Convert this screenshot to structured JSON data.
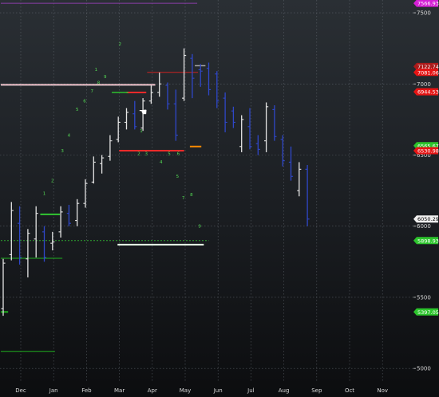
{
  "chart_data": {
    "type": "ohlc",
    "x_categories": [
      "Dec",
      "Jan",
      "Feb",
      "Mar",
      "Apr",
      "May",
      "Jun",
      "Jul",
      "Aug",
      "Sep",
      "Oct",
      "Nov"
    ],
    "yticks": [
      "7500",
      "7000",
      "6500",
      "6000",
      "5500",
      "5000"
    ],
    "ylim": [
      4900,
      7590
    ],
    "grid": true,
    "price_labels": [
      {
        "text": "7566.93",
        "value": 7566.9,
        "color": "#d51fd5"
      },
      {
        "text": "7122.74",
        "value": 7122.7,
        "color": "#aa1a1a"
      },
      {
        "text": "7081.06",
        "value": 7081.1,
        "color": "#e61414"
      },
      {
        "text": "6944.53",
        "value": 6944.5,
        "color": "#e61414"
      },
      {
        "text": "6565.67",
        "value": 6565.7,
        "color": "#2cc42c"
      },
      {
        "text": "6530.98",
        "value": 6531.0,
        "color": "#e61414"
      },
      {
        "text": "6050.29",
        "value": 6050.3,
        "color": "#f0f0f0"
      },
      {
        "text": "5898.93",
        "value": 5898.9,
        "color": "#2cc42c"
      },
      {
        "text": "5397.05",
        "value": 5397.1,
        "color": "#2cc42c"
      }
    ],
    "bars": [
      {
        "open": 5420,
        "high": 5770,
        "low": 5370,
        "close": 5740
      },
      {
        "open": 5800,
        "high": 6170,
        "low": 5760,
        "close": 6110
      },
      {
        "open": 6020,
        "high": 6140,
        "low": 5730,
        "close": 5780
      },
      {
        "open": 5770,
        "high": 5980,
        "low": 5640,
        "close": 5950
      },
      {
        "open": 5910,
        "high": 6140,
        "low": 5780,
        "close": 6090
      },
      {
        "open": 5960,
        "high": 6000,
        "low": 5750,
        "close": 5780
      },
      {
        "open": 5880,
        "high": 5960,
        "low": 5830,
        "close": 5890
      },
      {
        "open": 5960,
        "high": 6140,
        "low": 5920,
        "close": 6100
      },
      {
        "open": 6090,
        "high": 6150,
        "low": 6000,
        "close": 6020
      },
      {
        "open": 6040,
        "high": 6190,
        "low": 6000,
        "close": 6160
      },
      {
        "open": 6160,
        "high": 6330,
        "low": 6130,
        "close": 6300
      },
      {
        "open": 6310,
        "high": 6490,
        "low": 6300,
        "close": 6450
      },
      {
        "open": 6440,
        "high": 6500,
        "low": 6370,
        "close": 6480
      },
      {
        "open": 6490,
        "high": 6640,
        "low": 6460,
        "close": 6600
      },
      {
        "open": 6610,
        "high": 6770,
        "low": 6590,
        "close": 6730
      },
      {
        "open": 6730,
        "high": 6830,
        "low": 6680,
        "close": 6800
      },
      {
        "open": 6790,
        "high": 6880,
        "low": 6680,
        "close": 6700
      },
      {
        "open": 6690,
        "high": 6900,
        "low": 6670,
        "close": 6880
      },
      {
        "open": 6880,
        "high": 6990,
        "low": 6860,
        "close": 6940
      },
      {
        "open": 6940,
        "high": 7080,
        "low": 6910,
        "close": 7000
      },
      {
        "open": 6990,
        "high": 7010,
        "low": 6820,
        "close": 6860
      },
      {
        "open": 6860,
        "high": 6960,
        "low": 6600,
        "close": 6640
      },
      {
        "open": 6900,
        "high": 7250,
        "low": 6880,
        "close": 7200
      },
      {
        "open": 7180,
        "high": 7210,
        "low": 6900,
        "close": 7040
      },
      {
        "open": 7100,
        "high": 7140,
        "low": 6980,
        "close": 7090
      },
      {
        "open": 7110,
        "high": 7150,
        "low": 6920,
        "close": 6960
      },
      {
        "open": 7070,
        "high": 7090,
        "low": 6830,
        "close": 6880
      },
      {
        "open": 6900,
        "high": 6940,
        "low": 6660,
        "close": 6730
      },
      {
        "open": 6810,
        "high": 6840,
        "low": 6690,
        "close": 6730
      },
      {
        "open": 6560,
        "high": 6780,
        "low": 6520,
        "close": 6750
      },
      {
        "open": 6700,
        "high": 6830,
        "low": 6540,
        "close": 6560
      },
      {
        "open": 6580,
        "high": 6640,
        "low": 6500,
        "close": 6540
      },
      {
        "open": 6600,
        "high": 6870,
        "low": 6520,
        "close": 6840
      },
      {
        "open": 6820,
        "high": 6850,
        "low": 6600,
        "close": 6630
      },
      {
        "open": 6610,
        "high": 6640,
        "low": 6420,
        "close": 6460
      },
      {
        "open": 6450,
        "high": 6560,
        "low": 6320,
        "close": 6350
      },
      {
        "open": 6250,
        "high": 6450,
        "low": 6210,
        "close": 6400
      },
      {
        "open": 6400,
        "high": 6430,
        "low": 6000,
        "close": 6050
      }
    ],
    "levels": [
      {
        "value": 7566.9,
        "from": 0.0,
        "to": 23.6,
        "color": "#8a3fa8",
        "width": 1
      },
      {
        "value": 6994.0,
        "from": 0.0,
        "to": 18.5,
        "color": "#ffffff",
        "width": 2
      },
      {
        "value": 6994.0,
        "from": 0.0,
        "to": 18.5,
        "color": "#e89aa8",
        "width": 1
      },
      {
        "value": 7081.1,
        "from": 17.8,
        "to": 23.7,
        "color": "#cc2222",
        "width": 1
      },
      {
        "value": 7128.0,
        "from": 23.6,
        "to": 24.6,
        "color": "#a8a8a8",
        "width": 1.5
      },
      {
        "value": 6940.0,
        "from": 15.3,
        "to": 17.4,
        "color": "#ff2a2a",
        "width": 2
      },
      {
        "value": 6531.0,
        "from": 14.4,
        "to": 22.0,
        "color": "#ff2a2a",
        "width": 2
      },
      {
        "value": 6560.0,
        "from": 23.0,
        "to": 24.1,
        "color": "#ff8a00",
        "width": 2
      },
      {
        "value": 5898.9,
        "from": 0.0,
        "to": 25.0,
        "color": "#2ea62e",
        "width": 1,
        "dash": "2,2"
      },
      {
        "value": 5870.0,
        "from": 14.2,
        "to": 24.4,
        "color": "#eaffea",
        "width": 2
      },
      {
        "value": 6083.0,
        "from": 4.8,
        "to": 6.9,
        "color": "#32c832",
        "width": 2
      },
      {
        "value": 5774.0,
        "from": 0.0,
        "to": 7.2,
        "color": "#1fb01f",
        "width": 1
      },
      {
        "value": 5397.1,
        "from": 0.0,
        "to": 0.6,
        "color": "#1fb01f",
        "width": 2
      },
      {
        "value": 5120.0,
        "from": 0.0,
        "to": 6.3,
        "color": "#1fb01f",
        "width": 1
      },
      {
        "value": 6940.0,
        "from": 13.5,
        "to": 15.2,
        "color": "#2ec22e",
        "width": 1.5
      }
    ],
    "count_labels": [
      {
        "text": "1",
        "bar": 5.0,
        "value": 6220,
        "color": "#55dd55"
      },
      {
        "text": "2",
        "bar": 6.0,
        "value": 6310,
        "color": "#55dd55"
      },
      {
        "text": "3",
        "bar": 7.2,
        "value": 6520,
        "color": "#55dd55"
      },
      {
        "text": "4",
        "bar": 8.0,
        "value": 6630,
        "color": "#ff3030"
      },
      {
        "text": "5",
        "bar": 9.0,
        "value": 6810,
        "color": "#55dd55"
      },
      {
        "text": "6",
        "bar": 9.9,
        "value": 6870,
        "color": "#55dd55"
      },
      {
        "text": "7",
        "bar": 10.8,
        "value": 6940,
        "color": "#55dd55"
      },
      {
        "text": "8",
        "bar": 11.6,
        "value": 7000,
        "color": "#55dd55"
      },
      {
        "text": "9",
        "bar": 12.4,
        "value": 7040,
        "color": "#ff3030"
      },
      {
        "text": "1",
        "bar": 11.3,
        "value": 7090,
        "color": "#55dd55"
      },
      {
        "text": "2",
        "bar": 14.2,
        "value": 7270,
        "color": "#55dd55"
      },
      {
        "text": "1",
        "bar": 16.8,
        "value": 6660,
        "color": "#55dd55"
      },
      {
        "text": "2",
        "bar": 16.5,
        "value": 6500,
        "color": "#55dd55"
      },
      {
        "text": "3",
        "bar": 17.4,
        "value": 6500,
        "color": "#55dd55"
      },
      {
        "text": "4",
        "bar": 19.2,
        "value": 6440,
        "color": "#55dd55"
      },
      {
        "text": "5",
        "bar": 20.2,
        "value": 6500,
        "color": "#55dd55"
      },
      {
        "text": "6",
        "bar": 21.3,
        "value": 6500,
        "color": "#55dd55"
      },
      {
        "text": "5",
        "bar": 21.2,
        "value": 6340,
        "color": "#55dd55"
      },
      {
        "text": "7",
        "bar": 21.9,
        "value": 6190,
        "color": "#55dd55"
      },
      {
        "text": "8",
        "bar": 22.9,
        "value": 6210,
        "color": "#55dd55"
      },
      {
        "text": "9",
        "bar": 23.9,
        "value": 5990,
        "color": "#55dd55"
      }
    ],
    "hand_cursor": {
      "bar": 17.0,
      "value": 6780
    }
  }
}
